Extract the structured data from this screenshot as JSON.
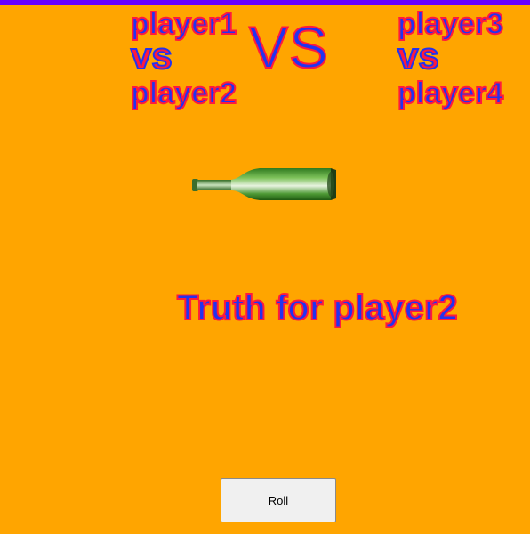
{
  "colors": {
    "background": "#FFA500",
    "top_bar": "#6600FF",
    "text_fill": "#2233EE",
    "text_outline": "#FF1A3C"
  },
  "match_left": {
    "player_a": "player1",
    "vs": "vs",
    "player_b": "player2"
  },
  "center_vs": "VS",
  "match_right": {
    "player_a": "player3",
    "vs": "vs",
    "player_b": "player4"
  },
  "bottle": {
    "icon": "bottle-icon"
  },
  "result_text": "Truth for player2",
  "roll_button_label": "Roll"
}
